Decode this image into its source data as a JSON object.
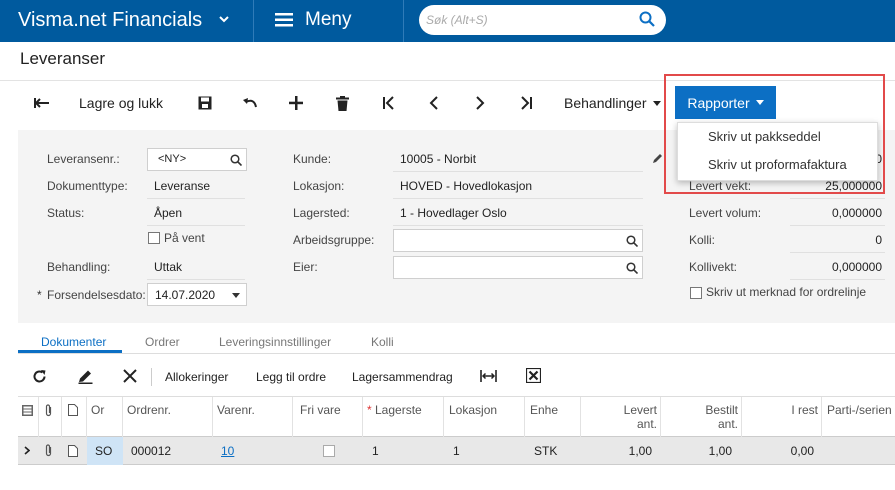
{
  "app": {
    "title": "Visma.net Financials",
    "menu_label": "Meny",
    "search_placeholder": "Søk (Alt+S)"
  },
  "page": {
    "title": "Leveranser"
  },
  "toolbar": {
    "save_close": "Lagre og lukk",
    "actions": "Behandlinger",
    "reports": "Rapporter"
  },
  "reports_menu": {
    "items": [
      "Skriv ut pakkseddel",
      "Skriv ut proformafaktura"
    ]
  },
  "form": {
    "shipment_nr_label": "Leveransenr.:",
    "shipment_nr_value": "<NY>",
    "doc_type_label": "Dokumenttype:",
    "doc_type_value": "Leveranse",
    "status_label": "Status:",
    "status_value": "Åpen",
    "on_hold_label": "På vent",
    "operation_label": "Behandling:",
    "operation_value": "Uttak",
    "ship_date_required": "*",
    "ship_date_label": "Forsendelsesdato:",
    "ship_date_value": "14.07.2020",
    "customer_label": "Kunde:",
    "customer_value": "10005 - Norbit",
    "location_label": "Lokasjon:",
    "location_value": "HOVED - Hovedlokasjon",
    "warehouse_label": "Lagersted:",
    "warehouse_value": "1 - Hovedlager Oslo",
    "workgroup_label": "Arbeidsgruppe:",
    "owner_label": "Eier:",
    "weight_label": "Levert vekt:",
    "weight_value": "25,000000",
    "weight_partial_right": "0",
    "volume_label": "Levert volum:",
    "volume_value": "0,000000",
    "packages_label": "Kolli:",
    "packages_value": "0",
    "package_weight_label": "Kollivekt:",
    "package_weight_value": "0,000000",
    "print_note_label": "Skriv ut merknad for ordrelinje"
  },
  "tabs": [
    "Dokumenter",
    "Ordrer",
    "Leveringsinnstillinger",
    "Kolli"
  ],
  "grid_toolbar": {
    "allocations": "Allokeringer",
    "add_order": "Legg til ordre",
    "inventory_summary": "Lagersammendrag"
  },
  "grid": {
    "headers": {
      "type": "Or",
      "order_nr": "Ordrenr.",
      "item_nr": "Varenr.",
      "free_item": "Fri vare",
      "warehouse_req": "*",
      "warehouse": "Lagerste",
      "location": "Lokasjon",
      "uom": "Enhe",
      "shipped_qty_1": "Levert",
      "shipped_qty_2": "ant.",
      "ordered_qty_1": "Bestilt",
      "ordered_qty_2": "ant.",
      "open": "I rest",
      "lot_serial": "Parti-/serien"
    },
    "rows": [
      {
        "type": "SO",
        "order_nr": "000012",
        "item_nr": "10",
        "warehouse": "1",
        "location": "1",
        "uom": "STK",
        "shipped": "1,00",
        "ordered": "1,00",
        "open": "0,00"
      }
    ]
  },
  "colors": {
    "topbar": "#005a9e",
    "accent": "#0c6fc4",
    "highlight": "#e24a4a"
  }
}
